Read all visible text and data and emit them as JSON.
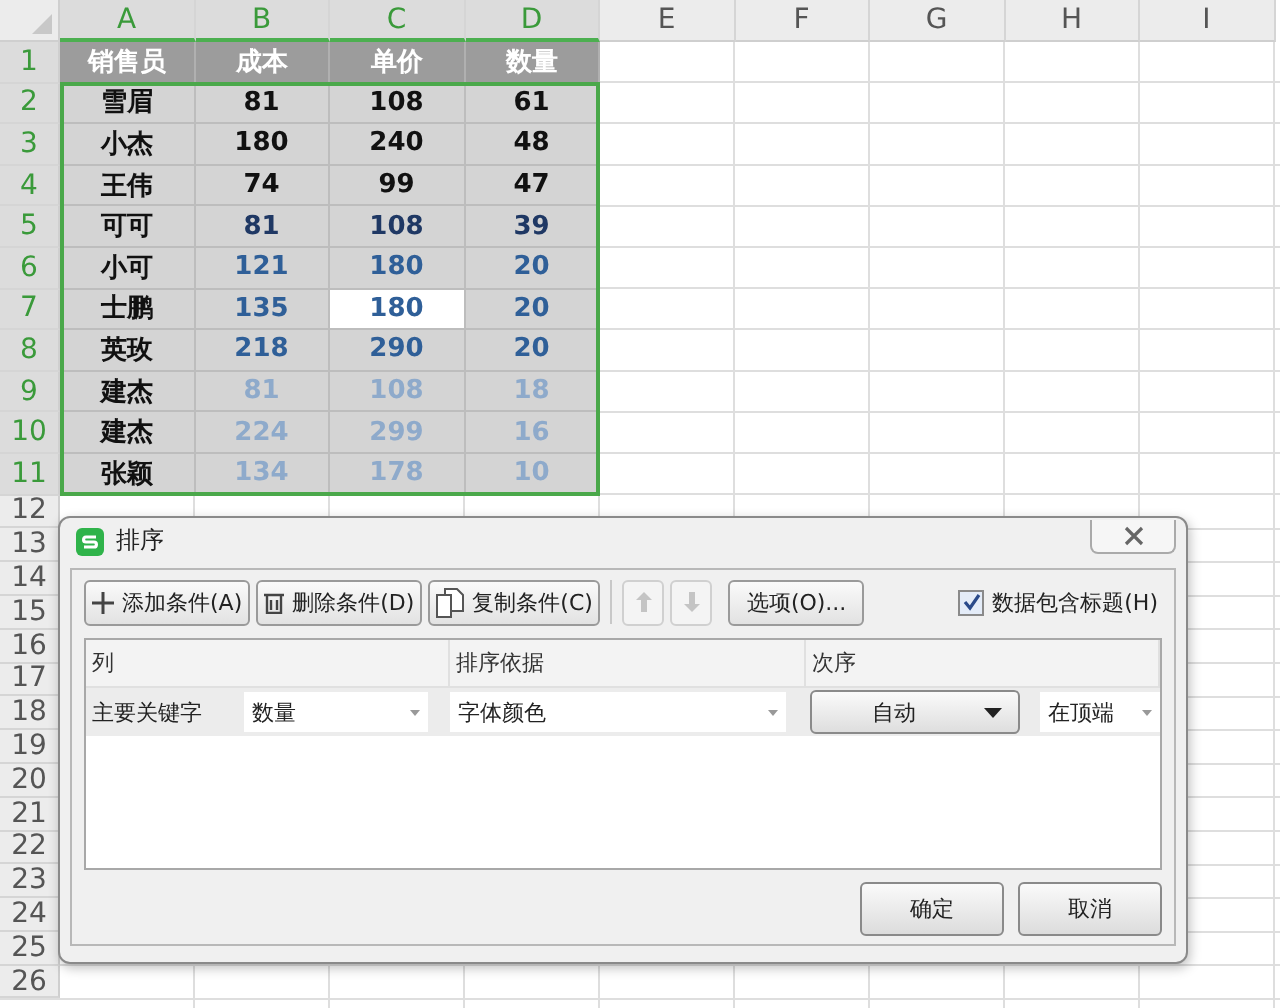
{
  "sheet": {
    "column_headers": [
      {
        "label": "A",
        "selected": true
      },
      {
        "label": "B",
        "selected": true
      },
      {
        "label": "C",
        "selected": true
      },
      {
        "label": "D",
        "selected": true
      },
      {
        "label": "E",
        "selected": false
      },
      {
        "label": "F",
        "selected": false
      },
      {
        "label": "G",
        "selected": false
      },
      {
        "label": "H",
        "selected": false
      },
      {
        "label": "I",
        "selected": false
      }
    ],
    "row_numbers": [
      {
        "label": "1",
        "selected": true
      },
      {
        "label": "2",
        "selected": true
      },
      {
        "label": "3",
        "selected": true
      },
      {
        "label": "4",
        "selected": true
      },
      {
        "label": "5",
        "selected": true
      },
      {
        "label": "6",
        "selected": true
      },
      {
        "label": "7",
        "selected": true
      },
      {
        "label": "8",
        "selected": true
      },
      {
        "label": "9",
        "selected": true
      },
      {
        "label": "10",
        "selected": true
      },
      {
        "label": "11",
        "selected": true
      },
      {
        "label": "12",
        "selected": false
      },
      {
        "label": "13",
        "selected": false
      },
      {
        "label": "14",
        "selected": false
      },
      {
        "label": "15",
        "selected": false
      },
      {
        "label": "16",
        "selected": false
      },
      {
        "label": "17",
        "selected": false
      },
      {
        "label": "18",
        "selected": false
      },
      {
        "label": "19",
        "selected": false
      },
      {
        "label": "20",
        "selected": false
      },
      {
        "label": "21",
        "selected": false
      },
      {
        "label": "22",
        "selected": false
      },
      {
        "label": "23",
        "selected": false
      },
      {
        "label": "24",
        "selected": false
      },
      {
        "label": "25",
        "selected": false
      },
      {
        "label": "26",
        "selected": false
      }
    ],
    "header": [
      "销售员",
      "成本",
      "单价",
      "数量"
    ],
    "rows": [
      {
        "color": "#111111",
        "cells": [
          {
            "text": "雪眉",
            "selected": false
          },
          {
            "text": "81",
            "selected": false
          },
          {
            "text": "108",
            "selected": false
          },
          {
            "text": "61",
            "selected": false
          }
        ]
      },
      {
        "color": "#111111",
        "cells": [
          {
            "text": "小杰",
            "selected": false
          },
          {
            "text": "180",
            "selected": false
          },
          {
            "text": "240",
            "selected": false
          },
          {
            "text": "48",
            "selected": false
          }
        ]
      },
      {
        "color": "#111111",
        "cells": [
          {
            "text": "王伟",
            "selected": false
          },
          {
            "text": "74",
            "selected": false
          },
          {
            "text": "99",
            "selected": false
          },
          {
            "text": "47",
            "selected": false
          }
        ]
      },
      {
        "color": "#1f3864",
        "cells": [
          {
            "text": "可可",
            "selected": false
          },
          {
            "text": "81",
            "selected": false
          },
          {
            "text": "108",
            "selected": false
          },
          {
            "text": "39",
            "selected": false
          }
        ]
      },
      {
        "color": "#2f5f98",
        "cells": [
          {
            "text": "小可",
            "selected": false
          },
          {
            "text": "121",
            "selected": false
          },
          {
            "text": "180",
            "selected": false
          },
          {
            "text": "20",
            "selected": false
          }
        ]
      },
      {
        "color": "#2f5f98",
        "cells": [
          {
            "text": "士鹏",
            "selected": false
          },
          {
            "text": "135",
            "selected": false
          },
          {
            "text": "180",
            "selected": true
          },
          {
            "text": "20",
            "selected": false
          }
        ]
      },
      {
        "color": "#2f5f98",
        "cells": [
          {
            "text": "英玫",
            "selected": false
          },
          {
            "text": "218",
            "selected": false
          },
          {
            "text": "290",
            "selected": false
          },
          {
            "text": "20",
            "selected": false
          }
        ]
      },
      {
        "color": "#8eaacb",
        "cells": [
          {
            "text": "建杰",
            "selected": false
          },
          {
            "text": "81",
            "selected": false
          },
          {
            "text": "108",
            "selected": false
          },
          {
            "text": "18",
            "selected": false
          }
        ]
      },
      {
        "color": "#8eaacb",
        "cells": [
          {
            "text": "建杰",
            "selected": false
          },
          {
            "text": "224",
            "selected": false
          },
          {
            "text": "299",
            "selected": false
          },
          {
            "text": "16",
            "selected": false
          }
        ]
      },
      {
        "color": "#8eaacb",
        "cells": [
          {
            "text": "张颖",
            "selected": false
          },
          {
            "text": "134",
            "selected": false
          },
          {
            "text": "178",
            "selected": false
          },
          {
            "text": "10",
            "selected": false
          }
        ]
      }
    ]
  },
  "dialog": {
    "title": "排序",
    "toolbar": [
      {
        "kind": "add",
        "label": "添加条件(A)",
        "disabled": false
      },
      {
        "kind": "delete",
        "label": "删除条件(D)",
        "disabled": false
      },
      {
        "kind": "copy",
        "label": "复制条件(C)",
        "disabled": false
      },
      {
        "kind": "move-up",
        "disabled": true
      },
      {
        "kind": "move-down",
        "disabled": true
      },
      {
        "kind": "plain",
        "label": "选项(O)...",
        "disabled": false
      }
    ],
    "has_headers": {
      "label": "数据包含标题(H)",
      "checked": true
    },
    "columns": [
      "列",
      "排序依据",
      "次序"
    ],
    "conditions": [
      {
        "label": "主要关键字",
        "column": "数量",
        "sort_on": "字体颜色",
        "order": "自动",
        "position": "在顶端"
      }
    ],
    "buttons": [
      "确定",
      "取消"
    ]
  }
}
